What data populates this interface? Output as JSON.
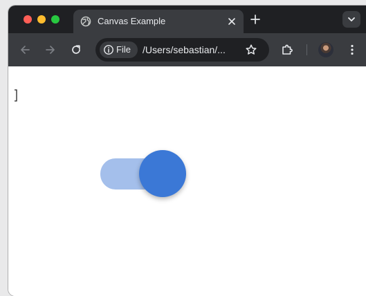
{
  "browser": {
    "tab": {
      "title": "Canvas Example"
    },
    "omnibox": {
      "chip_label": "File",
      "url": "/Users/sebastian/..."
    }
  },
  "icons": {
    "tab": "globe-icon",
    "close": "close-icon",
    "new_tab": "plus-icon",
    "back": "back-arrow-icon",
    "forward": "forward-arrow-icon",
    "reload": "reload-icon",
    "site_info": "info-icon",
    "bookmark": "star-icon",
    "extensions": "puzzle-icon",
    "menu": "kebab-menu-icon"
  },
  "colors": {
    "switch_track": "#a4bfeb",
    "switch_knob": "#3b78d6",
    "chrome_dark": "#1f2023",
    "chrome_toolbar": "#3a3c40"
  },
  "canvas": {
    "switch": {
      "state": "on"
    }
  }
}
